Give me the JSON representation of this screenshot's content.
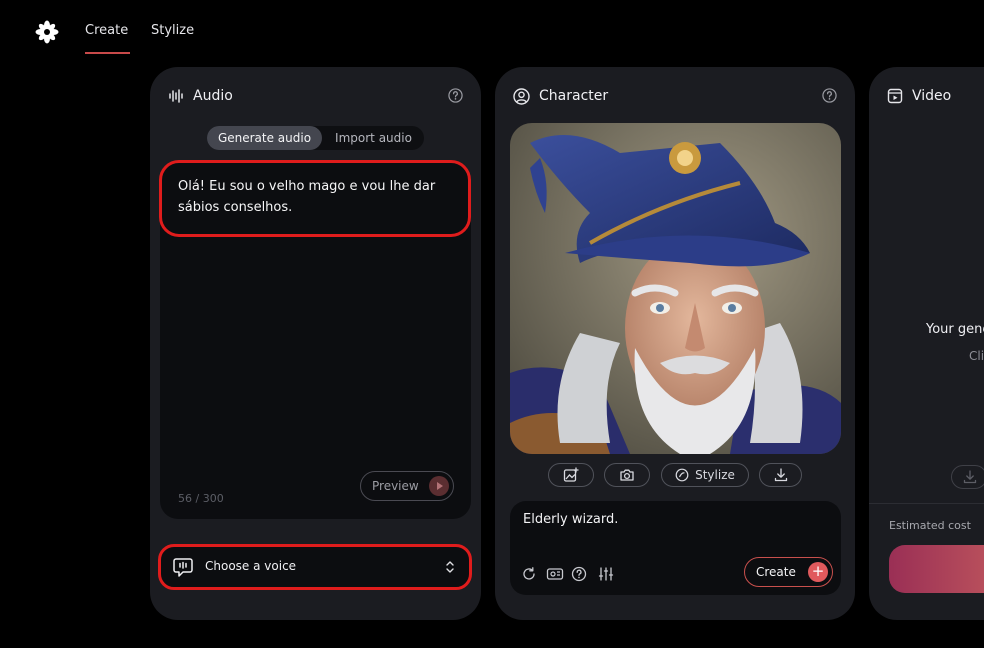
{
  "nav": {
    "create_label": "Create",
    "stylize_label": "Stylize"
  },
  "audio": {
    "title": "Audio",
    "tabs": {
      "generate": "Generate audio",
      "import": "Import audio"
    },
    "prompt": "Olá! Eu sou o velho mago e vou lhe dar sábios conselhos.",
    "counter": "56 / 300",
    "preview_label": "Preview",
    "voice_label": "Choose a voice"
  },
  "character": {
    "title": "Character",
    "stylize_label": "Stylize",
    "description": "Elderly wizard.",
    "create_label": "Create"
  },
  "video": {
    "title": "Video",
    "message": "Your gene",
    "sub": "Cli",
    "estimated_cost_label": "Estimated cost"
  },
  "colors": {
    "accent": "#e05a5d",
    "highlight": "#e01c1c",
    "card": "#1b1c21",
    "panel": "#0c0d10"
  }
}
